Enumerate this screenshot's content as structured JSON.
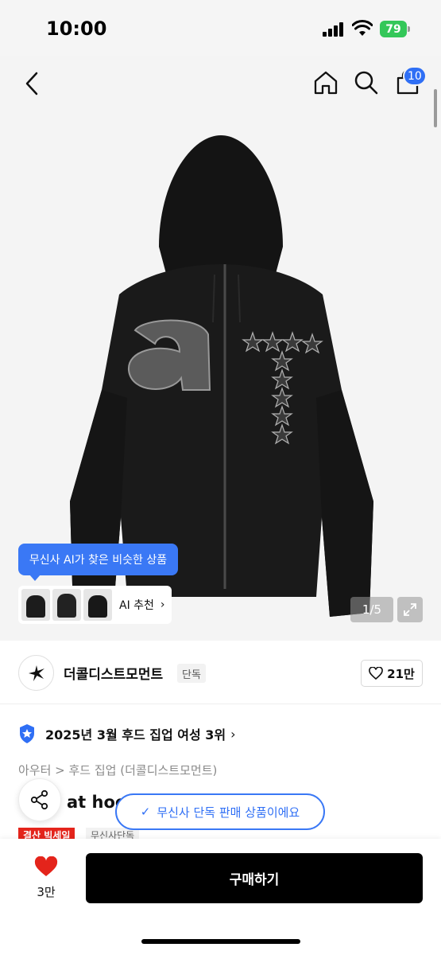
{
  "status_bar": {
    "time": "10:00",
    "battery": "79"
  },
  "nav": {
    "cart_count": "10"
  },
  "hero": {
    "ai_tooltip": "무신사 AI가 찾은 비슷한 상품",
    "ai_recommend_label": "AI 추천",
    "image_counter": "1/5"
  },
  "brand": {
    "name": "더콜디스트모먼트",
    "tag": "단독",
    "likes": "21만"
  },
  "ranking": {
    "text": "2025년 3월 후드 집업 여성 3위"
  },
  "breadcrumb": "아우터 > 후드 집업 (더콜디스트모먼트)",
  "product": {
    "title": "at hoo",
    "exclusive_notice": "무신사 단독 판매 상품이에요",
    "sale_tag": "결산 빅세일",
    "exclusive_tag": "무신사단독"
  },
  "bottom_bar": {
    "wish_count": "3만",
    "buy_label": "구매하기"
  },
  "colors": {
    "accent": "#2f6ff5",
    "sale": "#e4241b",
    "like": "#e4241b",
    "buy_button": "#000000"
  },
  "icons": [
    "back-icon",
    "home-icon",
    "search-icon",
    "bag-icon",
    "expand-icon",
    "heart-icon",
    "share-icon",
    "rank-badge-icon",
    "brand-logo-icon",
    "check-icon"
  ]
}
